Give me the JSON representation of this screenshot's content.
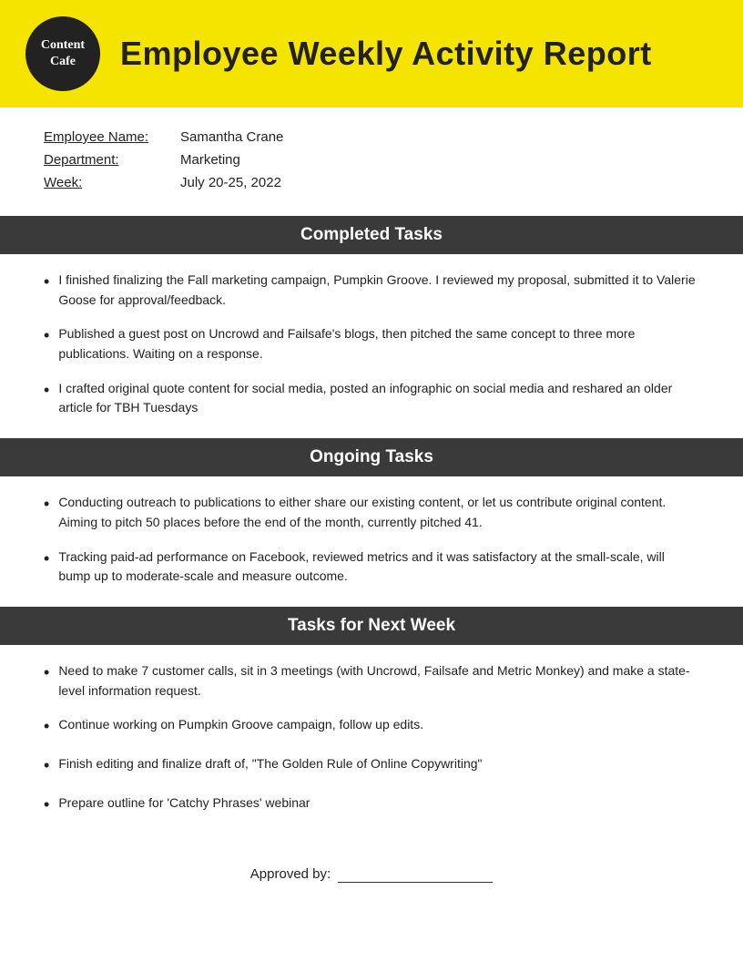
{
  "header": {
    "logo_line1": "Content",
    "logo_line2": "Cafe",
    "title": "Employee Weekly Activity Report"
  },
  "info": {
    "employee_name_label": "Employee Name:",
    "employee_name_value": "Samantha Crane",
    "department_label": "Department:",
    "department_value": "Marketing",
    "week_label": "Week:",
    "week_value": "July 20-25, 2022"
  },
  "sections": {
    "completed": {
      "title": "Completed Tasks",
      "tasks": [
        "I finished finalizing the Fall marketing campaign, Pumpkin Groove. I reviewed my proposal, submitted it to Valerie Goose for approval/feedback.",
        "Published a guest post on Uncrowd and Failsafe's blogs, then pitched the same concept to three more publications. Waiting on a response.",
        "I crafted original quote content for social media, posted an infographic on social media and reshared an older article for TBH Tuesdays"
      ]
    },
    "ongoing": {
      "title": "Ongoing Tasks",
      "tasks": [
        "Conducting outreach to publications to either share our existing content, or let us contribute original content. Aiming to pitch 50 places before the end of the month, currently pitched 41.",
        "Tracking paid-ad performance on Facebook, reviewed metrics and it was satisfactory at the small-scale, will bump up to moderate-scale and measure outcome."
      ]
    },
    "next_week": {
      "title": "Tasks for Next Week",
      "tasks": [
        "Need to make 7 customer calls, sit in 3 meetings (with Uncrowd, Failsafe and Metric Monkey) and make a state-level information request.",
        "Continue working on Pumpkin Groove campaign, follow up edits.",
        "Finish editing and finalize draft of, \"The Golden Rule of Online Copywriting\"",
        "Prepare outline for 'Catchy Phrases' webinar"
      ]
    }
  },
  "approved": {
    "label": "Approved by:"
  }
}
